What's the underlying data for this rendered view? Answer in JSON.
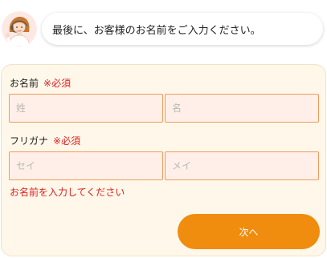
{
  "assistant": {
    "message": "最後に、お客様のお名前をご入力ください。",
    "avatar_icon": "support-operator-avatar"
  },
  "form": {
    "name": {
      "label": "お名前",
      "required": "※必須",
      "last_placeholder": "姓",
      "first_placeholder": "名",
      "last_value": "",
      "first_value": ""
    },
    "kana": {
      "label": "フリガナ",
      "required": "※必須",
      "last_placeholder": "セイ",
      "first_placeholder": "メイ",
      "last_value": "",
      "first_value": ""
    },
    "error_message": "お名前を入力してください",
    "next_button": "次へ"
  },
  "colors": {
    "accent": "#f08c0e",
    "error": "#e02020",
    "card_background": "#fff8ea",
    "field_background": "#ffefe8",
    "field_border": "#ee9b5c"
  }
}
